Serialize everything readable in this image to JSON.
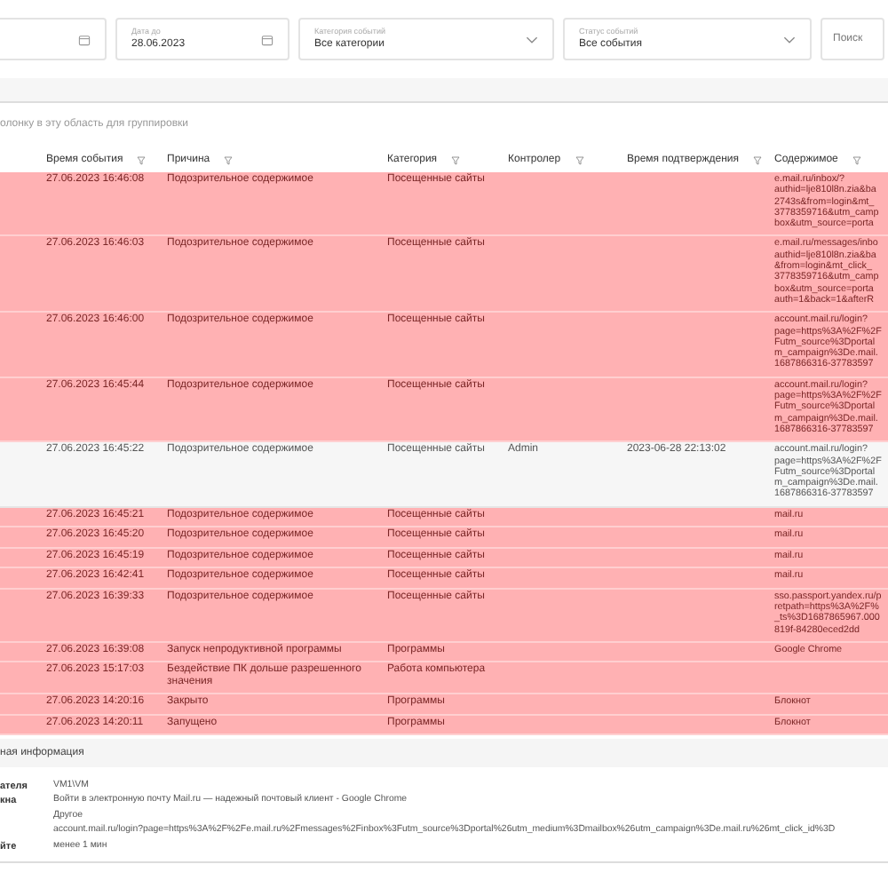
{
  "filters": [
    {
      "kind": "date"
    },
    {
      "kind": "date",
      "label": "Дата до",
      "value": "28.06.2023"
    },
    {
      "kind": "select",
      "label": "Категория событий",
      "value": "Все категории"
    },
    {
      "kind": "select",
      "label": "Статус событий",
      "value": "Все события"
    }
  ],
  "search_button": "Поиск",
  "group_hint": "олонку в эту область для группировки",
  "table": {
    "columns": [
      {
        "label": "Время события"
      },
      {
        "label": "Причина"
      },
      {
        "label": "Категория"
      },
      {
        "label": "Контролер"
      },
      {
        "label": "Время подтверждения"
      },
      {
        "label": "Содержимое"
      }
    ],
    "rows": [
      {
        "confirmed": false,
        "time": "27.06.2023 16:46:08",
        "reason": "Подозрительное содержимое",
        "category": "Посещенные сайты",
        "controller": "",
        "confirmed_at": "",
        "content": "e.mail.ru/inbox/?\nauthid=lje810l8n.zia&ba\n2743s&from=login&mt_\n3778359716&utm_camp\nbox&utm_source=porta"
      },
      {
        "confirmed": false,
        "time": "27.06.2023 16:46:03",
        "reason": "Подозрительное содержимое",
        "category": "Посещенные сайты",
        "controller": "",
        "confirmed_at": "",
        "content": "e.mail.ru/messages/inbo\nauthid=lje810l8n.zia&ba\n&from=login&mt_click_\n3778359716&utm_camp\nbox&utm_source=porta\nauth=1&back=1&afterR"
      },
      {
        "confirmed": false,
        "time": "27.06.2023 16:46:00",
        "reason": "Подозрительное содержимое",
        "category": "Посещенные сайты",
        "controller": "",
        "confirmed_at": "",
        "content": "account.mail.ru/login?\npage=https%3A%2F%2F\nFutm_source%3Dportal\nm_campaign%3De.mail.\n1687866316-37783597"
      },
      {
        "confirmed": false,
        "time": "27.06.2023 16:45:44",
        "reason": "Подозрительное содержимое",
        "category": "Посещенные сайты",
        "controller": "",
        "confirmed_at": "",
        "content": "account.mail.ru/login?\npage=https%3A%2F%2F\nFutm_source%3Dportal\nm_campaign%3De.mail.\n1687866316-37783597"
      },
      {
        "confirmed": true,
        "time": "27.06.2023 16:45:22",
        "reason": "Подозрительное содержимое",
        "category": "Посещенные сайты",
        "controller": "Admin",
        "confirmed_at": "2023-06-28 22:13:02",
        "content": "account.mail.ru/login?\npage=https%3A%2F%2F\nFutm_source%3Dportal\nm_campaign%3De.mail.\n1687866316-37783597"
      },
      {
        "confirmed": false,
        "time": "27.06.2023 16:45:21",
        "reason": "Подозрительное содержимое",
        "category": "Посещенные сайты",
        "controller": "",
        "confirmed_at": "",
        "content": "mail.ru"
      },
      {
        "confirmed": false,
        "time": "27.06.2023 16:45:20",
        "reason": "Подозрительное содержимое",
        "category": "Посещенные сайты",
        "controller": "",
        "confirmed_at": "",
        "content": "mail.ru"
      },
      {
        "confirmed": false,
        "time": "27.06.2023 16:45:19",
        "reason": "Подозрительное содержимое",
        "category": "Посещенные сайты",
        "controller": "",
        "confirmed_at": "",
        "content": "mail.ru"
      },
      {
        "confirmed": false,
        "time": "27.06.2023 16:42:41",
        "reason": "Подозрительное содержимое",
        "category": "Посещенные сайты",
        "controller": "",
        "confirmed_at": "",
        "content": "mail.ru"
      },
      {
        "confirmed": false,
        "time": "27.06.2023 16:39:33",
        "reason": "Подозрительное содержимое",
        "category": "Посещенные сайты",
        "controller": "",
        "confirmed_at": "",
        "content": "sso.passport.yandex.ru/p\nretpath=https%3A%2F%\n_ts%3D1687865967.000\n819f-84280eced2dd"
      },
      {
        "confirmed": false,
        "time": "27.06.2023 16:39:08",
        "reason": "Запуск непродуктивной программы",
        "category": "Программы",
        "controller": "",
        "confirmed_at": "",
        "content": "Google Chrome"
      },
      {
        "confirmed": false,
        "time": "27.06.2023 15:17:03",
        "reason": "Бездействие ПК дольше разрешенного значения",
        "category": "Работа компьютера",
        "controller": "",
        "confirmed_at": "",
        "content": ""
      },
      {
        "confirmed": false,
        "time": "27.06.2023 14:20:16",
        "reason": "Закрыто",
        "category": "Программы",
        "controller": "",
        "confirmed_at": "",
        "content": "Блокнот"
      },
      {
        "confirmed": false,
        "time": "27.06.2023 14:20:11",
        "reason": "Запущено",
        "category": "Программы",
        "controller": "",
        "confirmed_at": "",
        "content": "Блокнот"
      }
    ]
  },
  "details": {
    "title": "ная информация",
    "fields": [
      {
        "label": "ателя",
        "value": "VM1\\VM"
      },
      {
        "label": "кна",
        "value": "Войти в электронную почту Mail.ru — надежный почтовый клиент - Google Chrome"
      },
      {
        "value": "Другое"
      },
      {
        "value": "account.mail.ru/login?page=https%3A%2F%2Fe.mail.ru%2Fmessages%2Finbox%3Futm_source%3Dportal%26utm_medium%3Dmailbox%26utm_campaign%3De.mail.ru%26mt_click_id%3D"
      },
      {
        "label": "йте",
        "value": "менее 1 мин"
      }
    ]
  }
}
